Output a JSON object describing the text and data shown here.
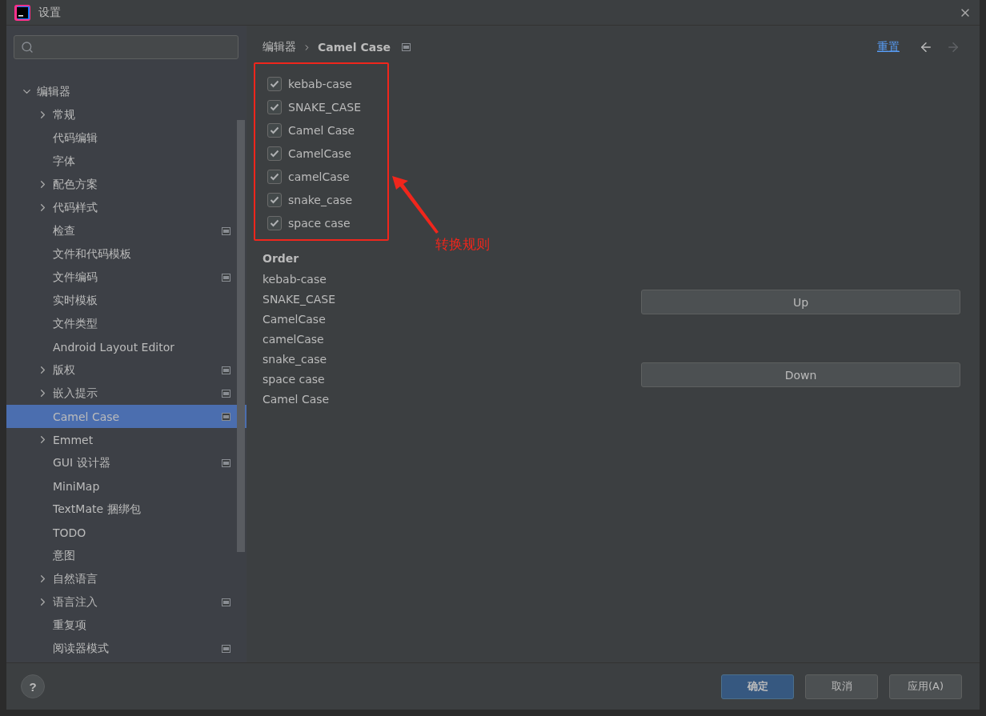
{
  "window": {
    "title": "设置"
  },
  "sidebar": {
    "items": [
      {
        "label": "编辑器",
        "expanded": true,
        "selected": false,
        "children": [
          {
            "label": "常规",
            "expanded": false,
            "selected": false,
            "scoped": false
          },
          {
            "label": "代码编辑",
            "selected": false,
            "scoped": false
          },
          {
            "label": "字体",
            "selected": false,
            "scoped": false
          },
          {
            "label": "配色方案",
            "expanded": false,
            "selected": false,
            "scoped": false
          },
          {
            "label": "代码样式",
            "expanded": false,
            "selected": false,
            "scoped": false
          },
          {
            "label": "检查",
            "selected": false,
            "scoped": true
          },
          {
            "label": "文件和代码模板",
            "selected": false,
            "scoped": false
          },
          {
            "label": "文件编码",
            "selected": false,
            "scoped": true
          },
          {
            "label": "实时模板",
            "selected": false,
            "scoped": false
          },
          {
            "label": "文件类型",
            "selected": false,
            "scoped": false
          },
          {
            "label": "Android Layout Editor",
            "selected": false,
            "scoped": false
          },
          {
            "label": "版权",
            "expanded": false,
            "selected": false,
            "scoped": true
          },
          {
            "label": "嵌入提示",
            "expanded": false,
            "selected": false,
            "scoped": true
          },
          {
            "label": "Camel Case",
            "selected": true,
            "scoped": true
          },
          {
            "label": "Emmet",
            "expanded": false,
            "selected": false,
            "scoped": false
          },
          {
            "label": "GUI 设计器",
            "selected": false,
            "scoped": true
          },
          {
            "label": "MiniMap",
            "selected": false,
            "scoped": false
          },
          {
            "label": "TextMate 捆绑包",
            "selected": false,
            "scoped": false
          },
          {
            "label": "TODO",
            "selected": false,
            "scoped": false
          },
          {
            "label": "意图",
            "selected": false,
            "scoped": false
          },
          {
            "label": "自然语言",
            "expanded": false,
            "selected": false,
            "scoped": false
          },
          {
            "label": "语言注入",
            "expanded": false,
            "selected": false,
            "scoped": true
          },
          {
            "label": "重复项",
            "selected": false,
            "scoped": false
          },
          {
            "label": "阅读器模式",
            "selected": false,
            "scoped": true
          }
        ]
      }
    ]
  },
  "breadcrumb": {
    "items": [
      "编辑器",
      "Camel Case"
    ],
    "scoped": true
  },
  "header_actions": {
    "reset": "重置",
    "back_disabled": false,
    "forward_disabled": true
  },
  "options": [
    {
      "label": "kebab-case",
      "checked": true
    },
    {
      "label": "SNAKE_CASE",
      "checked": true
    },
    {
      "label": "Camel Case",
      "checked": true
    },
    {
      "label": "CamelCase",
      "checked": true
    },
    {
      "label": "camelCase",
      "checked": true
    },
    {
      "label": "snake_case",
      "checked": true
    },
    {
      "label": "space case",
      "checked": true
    }
  ],
  "annotation": {
    "text": "转换规则"
  },
  "order": {
    "title": "Order",
    "items": [
      "kebab-case",
      "SNAKE_CASE",
      "CamelCase",
      "camelCase",
      "snake_case",
      "space case",
      "Camel Case"
    ],
    "buttons": [
      "Up",
      "Down"
    ]
  },
  "footer": {
    "help": "?",
    "buttons": [
      {
        "label": "确定",
        "primary": true
      },
      {
        "label": "取消",
        "primary": false
      },
      {
        "label": "应用(A)",
        "primary": false
      }
    ]
  }
}
